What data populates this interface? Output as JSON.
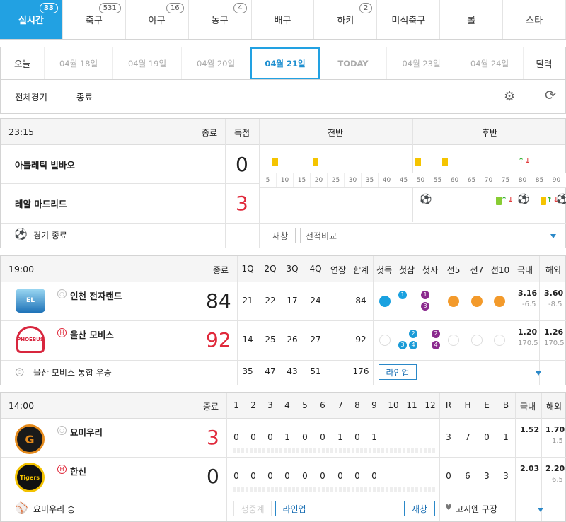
{
  "tabs": [
    {
      "label": "실시간",
      "count": "33"
    },
    {
      "label": "축구",
      "count": "531"
    },
    {
      "label": "야구",
      "count": "16"
    },
    {
      "label": "농구",
      "count": "4"
    },
    {
      "label": "배구",
      "count": ""
    },
    {
      "label": "하키",
      "count": "2"
    },
    {
      "label": "미식축구",
      "count": ""
    },
    {
      "label": "롤",
      "count": ""
    },
    {
      "label": "스타",
      "count": ""
    }
  ],
  "dates": [
    "오늘",
    "04월 18일",
    "04월 19일",
    "04월 20일",
    "04월 21일",
    "TODAY",
    "04월 23일",
    "04월 24일",
    "달력"
  ],
  "filter": {
    "all": "전체경기",
    "end": "종료"
  },
  "soccer": {
    "time": "23:15",
    "status": "종료",
    "score_label": "득점",
    "first_half": "전반",
    "second_half": "후반",
    "home": {
      "name": "아틀레틱 빌바오",
      "score": "0"
    },
    "away": {
      "name": "레알 마드리드",
      "score": "3"
    },
    "footer": "경기 종료",
    "refresh": "새창",
    "compare": "전적비교",
    "minutes": [
      "5",
      "10",
      "15",
      "20",
      "25",
      "30",
      "35",
      "40",
      "45",
      "50",
      "55",
      "60",
      "65",
      "70",
      "75",
      "80",
      "85",
      "90"
    ]
  },
  "basketball": {
    "time": "19:00",
    "status": "종료",
    "cols": [
      "1Q",
      "2Q",
      "3Q",
      "4Q",
      "연장",
      "합계",
      "첫득",
      "첫삼",
      "첫자",
      "선5",
      "선7",
      "선10",
      "국내",
      "해외"
    ],
    "home": {
      "name": "인천 전자랜드",
      "tag": "○",
      "score": "84",
      "q": [
        "21",
        "22",
        "17",
        "24",
        "",
        "84"
      ],
      "domestic": "3.16",
      "domestic_sub": "-6.5",
      "foreign": "3.60",
      "foreign_sub": "-8.5"
    },
    "away": {
      "name": "울산 모비스",
      "tag": "H",
      "score": "92",
      "q": [
        "14",
        "25",
        "26",
        "27",
        "",
        "92"
      ],
      "domestic": "1.20",
      "domestic_sub": "170.5",
      "foreign": "1.26",
      "foreign_sub": "170.5"
    },
    "footer": "울산 모비스 통합 우승",
    "totals": [
      "35",
      "47",
      "43",
      "51",
      "",
      "176"
    ],
    "lineup": "라인업",
    "dots_home": [
      "1",
      "1",
      "3"
    ],
    "dots_away": [
      "2",
      "3",
      "4",
      "2",
      "4"
    ]
  },
  "baseball": {
    "time": "14:00",
    "status": "종료",
    "innings": [
      "1",
      "2",
      "3",
      "4",
      "5",
      "6",
      "7",
      "8",
      "9",
      "10",
      "11",
      "12",
      "R",
      "H",
      "E",
      "B",
      "국내",
      "해외"
    ],
    "home": {
      "name": "요미우리",
      "tag": "○",
      "score": "3",
      "inn": [
        "0",
        "0",
        "0",
        "1",
        "0",
        "0",
        "1",
        "0",
        "1",
        "",
        "",
        "",
        "3",
        "7",
        "0",
        "1"
      ],
      "domestic": "1.52",
      "foreign": "1.70",
      "foreign_sub": "1.5"
    },
    "away": {
      "name": "한신",
      "tag": "H",
      "score": "0",
      "inn": [
        "0",
        "0",
        "0",
        "0",
        "0",
        "0",
        "0",
        "0",
        "0",
        "",
        "",
        "",
        "0",
        "6",
        "3",
        "3"
      ],
      "domestic": "2.03",
      "foreign": "2.20",
      "foreign_sub": "6.5"
    },
    "footer": "요미우리 승",
    "live": "생중계",
    "lineup": "라인업",
    "window": "새창",
    "stadium": "고시엔 구장"
  },
  "colors": {
    "accent": "#22a1e2",
    "red": "#e0283a",
    "orange": "#f39a2b",
    "purple": "#8b2a8e",
    "teal": "#1a9bd7"
  }
}
